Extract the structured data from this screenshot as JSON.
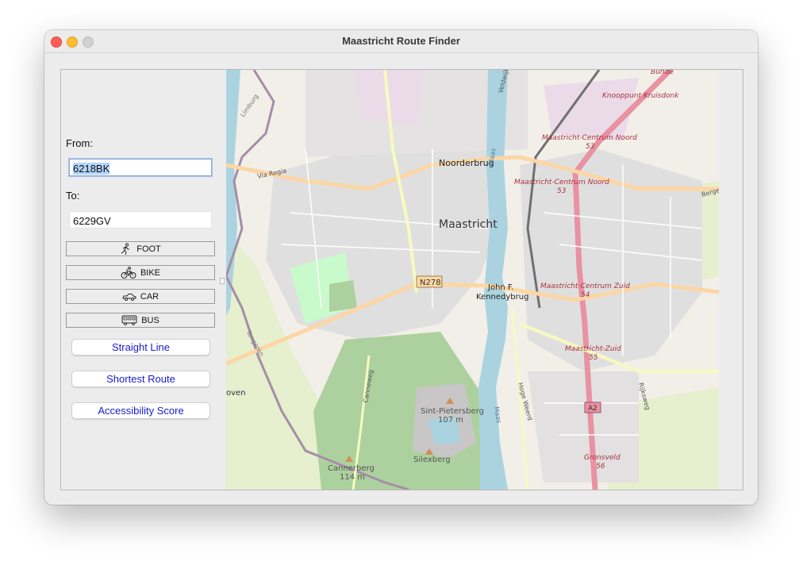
{
  "window": {
    "title": "Maastricht Route Finder"
  },
  "form": {
    "from_label": "From:",
    "from_value": "6218BK",
    "to_label": "To:",
    "to_value": "6229GV"
  },
  "modes": [
    {
      "label": "FOOT",
      "icon": "walking-person-icon"
    },
    {
      "label": "BIKE",
      "icon": "bicycle-icon"
    },
    {
      "label": "CAR",
      "icon": "car-icon"
    },
    {
      "label": "BUS",
      "icon": "bus-icon"
    }
  ],
  "actions": {
    "straight_line": "Straight Line",
    "shortest_route": "Shortest Route",
    "accessibility_score": "Accessibility Score"
  },
  "map": {
    "city": "Maastricht",
    "labels": {
      "noorderbrug": "Noorderbrug",
      "kennedy_1": "John F.",
      "kennedy_2": "Kennedybrug",
      "n278": "N278",
      "a2": "A2",
      "sintpieters_1": "Sint-Pietersberg",
      "sintpieters_2": "107 m",
      "cannerberg_1": "Cannerberg",
      "cannerberg_2": "114 m",
      "silexberg": "Silexberg",
      "knooppunt": "Knooppunt Kruisdonk",
      "bunde": "Bunde",
      "mcn_1": "Maastricht-Centrum Noord",
      "mcn_1_num": "53",
      "mcn_2": "Maastricht-Centrum Noord",
      "mcn_2_num": "53",
      "mcz": "Maastricht-Centrum Zuid",
      "mcz_num": "54",
      "mz": "Maastricht-Zuid",
      "mz_num": "55",
      "gronsveld": "Gronsveld",
      "gronsveld_num": "56",
      "via_regia": "Via Regia",
      "limburg": "Limburg",
      "tongeren": "Tongeren",
      "canneweg": "Canneweg",
      "hoge_weerd": "Hoge Weerd",
      "maas": "Maas",
      "maas_top": "Maas",
      "rijksweg": "Rijksweg",
      "berg": "Berge",
      "oven": "oven",
      "veldwijk": "Veldwijk"
    }
  }
}
